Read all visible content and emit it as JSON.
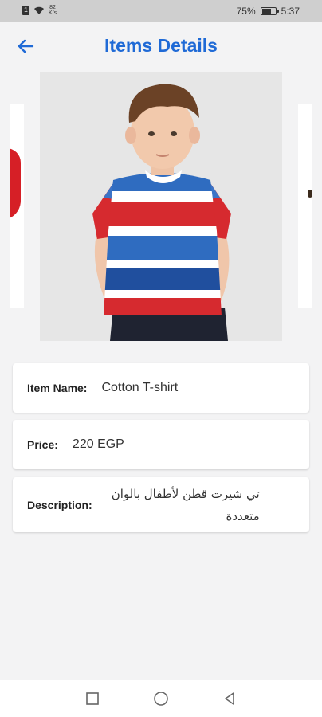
{
  "status_bar": {
    "net_speed_value": "82",
    "net_speed_unit": "K/s",
    "battery_percent": "75%",
    "battery_level": 0.75,
    "time": "5:37"
  },
  "header": {
    "title": "Items Details"
  },
  "item": {
    "name_label": "Item Name:",
    "name_value": "Cotton T-shirt",
    "price_label": "Price:",
    "price_value": "220 EGP",
    "description_label": "Description:",
    "description_value": "تي شيرت قطن  لأطفال بالوان متعددة"
  },
  "colors": {
    "accent": "#1f6ad6",
    "background": "#f3f3f4"
  },
  "icons": {
    "back": "arrow-left-icon",
    "nav_recents": "square-icon",
    "nav_home": "circle-icon",
    "nav_back": "triangle-back-icon"
  }
}
